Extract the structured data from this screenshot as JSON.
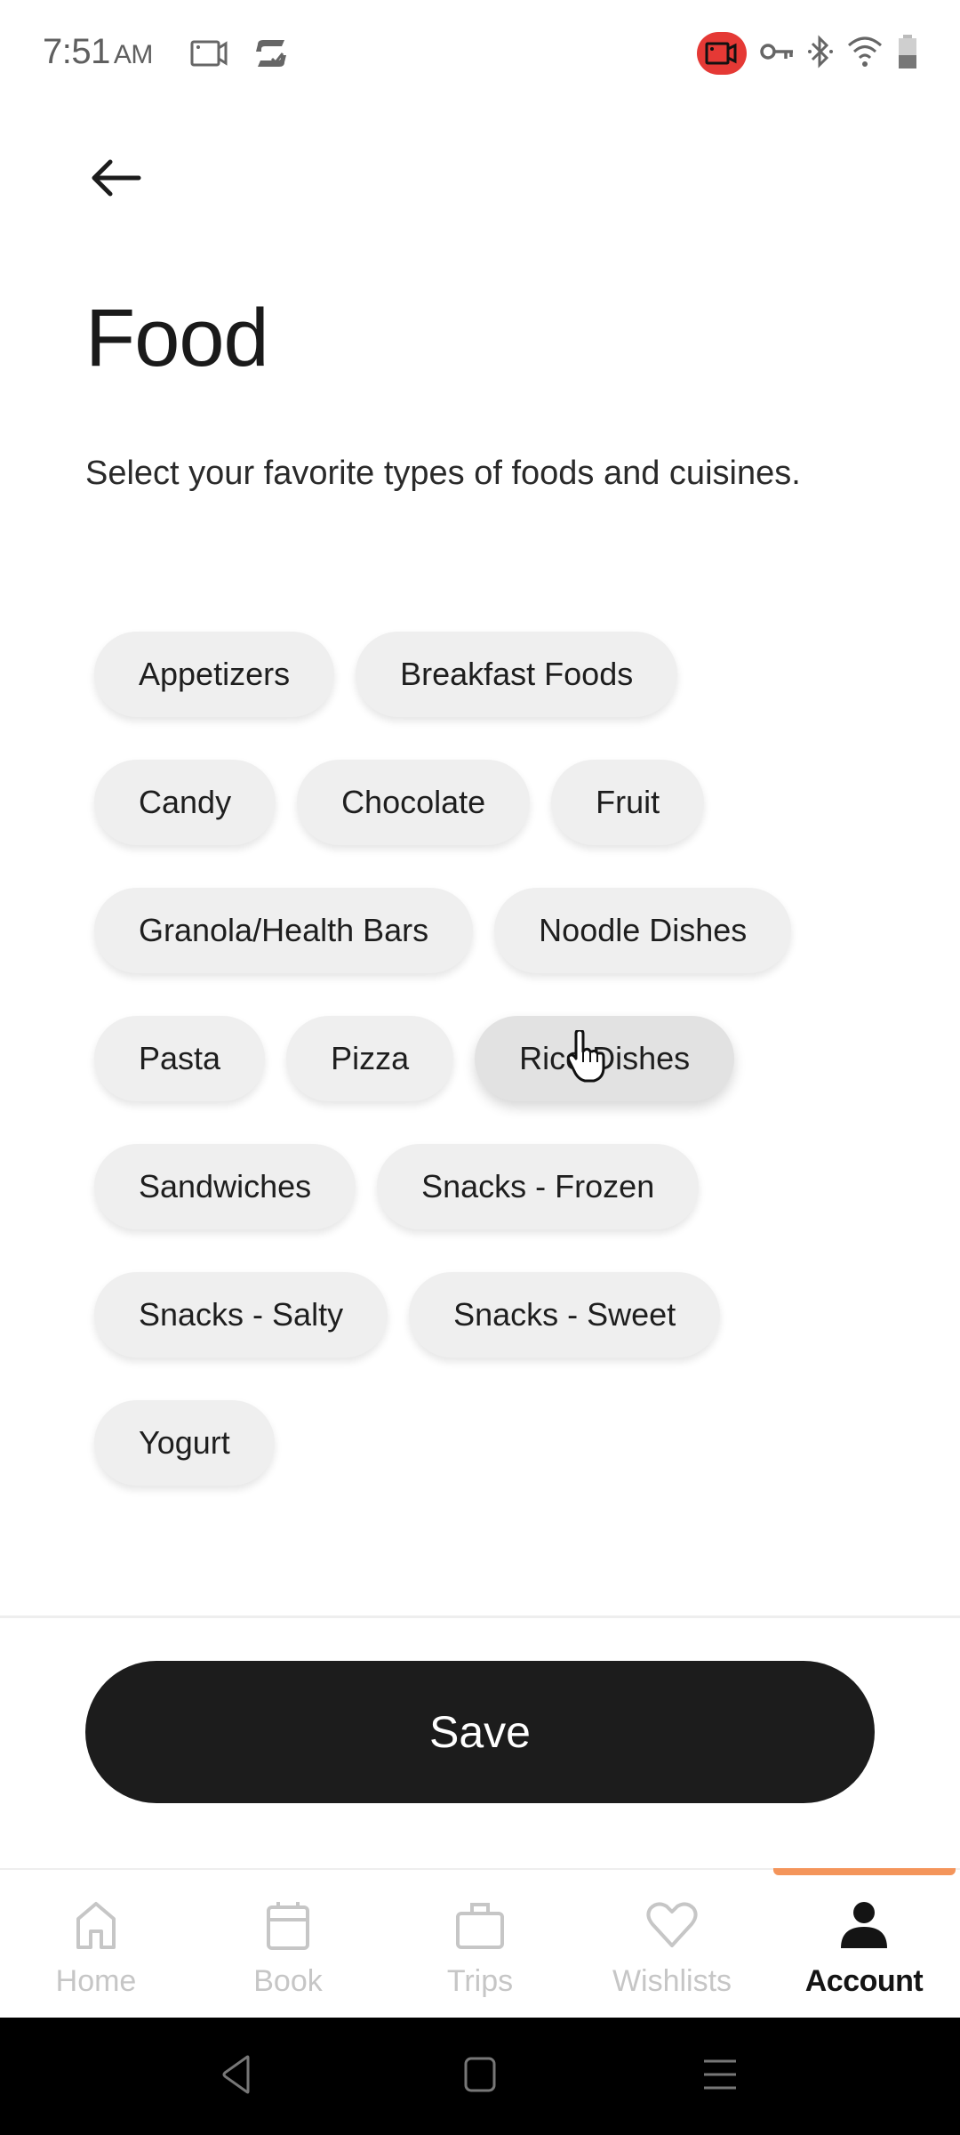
{
  "status_bar": {
    "time": "7:51",
    "ampm": "AM",
    "left_icons": [
      "screen-record-icon",
      "sync-app-icon"
    ],
    "right_icons": [
      "recording-icon",
      "vpn-key-icon",
      "bluetooth-icon",
      "wifi-icon",
      "battery-icon"
    ],
    "recording_color": "#e53935"
  },
  "header": {
    "back_icon": "arrow-left-icon",
    "title": "Food",
    "subtitle": "Select your favorite types of foods and cuisines."
  },
  "chips": {
    "rows": [
      [
        "Appetizers",
        "Breakfast Foods"
      ],
      [
        "Candy",
        "Chocolate",
        "Fruit"
      ],
      [
        "Granola/Health Bars",
        "Noodle Dishes"
      ],
      [
        "Pasta",
        "Pizza",
        "Rice Dishes"
      ],
      [
        "Sandwiches",
        "Snacks - Frozen"
      ],
      [
        "Snacks - Salty",
        "Snacks - Sweet"
      ],
      [
        "Yogurt"
      ]
    ],
    "pressed": "Rice Dishes"
  },
  "footer": {
    "save_label": "Save"
  },
  "bottom_nav": {
    "items": [
      {
        "label": "Home",
        "icon": "home-icon",
        "active": false
      },
      {
        "label": "Book",
        "icon": "calendar-icon",
        "active": false
      },
      {
        "label": "Trips",
        "icon": "briefcase-icon",
        "active": false
      },
      {
        "label": "Wishlists",
        "icon": "heart-icon",
        "active": false
      },
      {
        "label": "Account",
        "icon": "person-icon",
        "active": true
      }
    ],
    "active_indicator_color": "#f4955b"
  },
  "system_nav": {
    "buttons": [
      "back-icon",
      "home-square-icon",
      "recents-menu-icon"
    ]
  }
}
